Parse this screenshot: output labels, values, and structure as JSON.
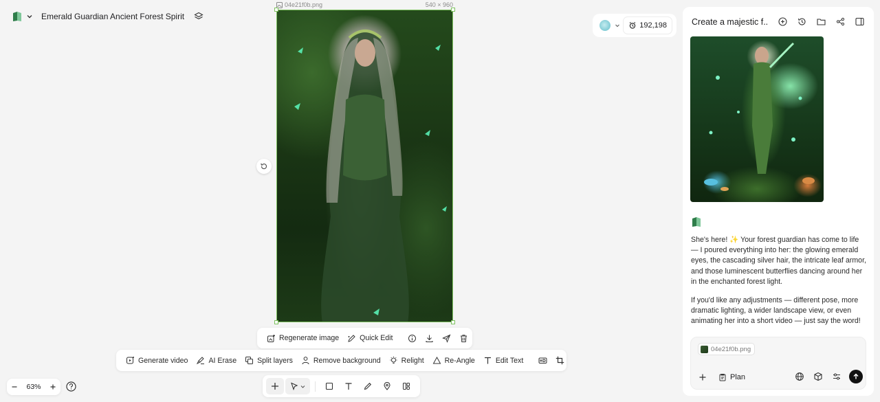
{
  "project": {
    "title": "Emerald Guardian Ancient Forest Spirit"
  },
  "canvas": {
    "image_name": "04e21f0b.png",
    "image_size": "540 × 960"
  },
  "topbar": {
    "credits": "192,198"
  },
  "chat": {
    "title": "Create a majestic f...",
    "message_1": "She's here! ✨ Your forest guardian has come to life — I poured everything into her: the glowing emerald eyes, the cascading silver hair, the intricate leaf armor, and those luminescent butterflies dancing around her in the enchanted forest light.",
    "message_2": "If you'd like any adjustments — different pose, more dramatic lighting, a wider landscape view, or even animating her into a short video — just say the word!",
    "attachment": "04e21f0b.png",
    "plan_label": "Plan"
  },
  "image_toolbar": {
    "regenerate": "Regenerate image",
    "quick_edit": "Quick Edit"
  },
  "edit_toolbar": {
    "generate_video": "Generate video",
    "ai_erase": "AI Erase",
    "split_layers": "Split layers",
    "remove_background": "Remove background",
    "relight": "Relight",
    "re_angle": "Re-Angle",
    "edit_text": "Edit Text"
  },
  "zoom": {
    "level": "63%"
  },
  "colors": {
    "selection": "#7cc15d",
    "send_button": "#111111"
  }
}
